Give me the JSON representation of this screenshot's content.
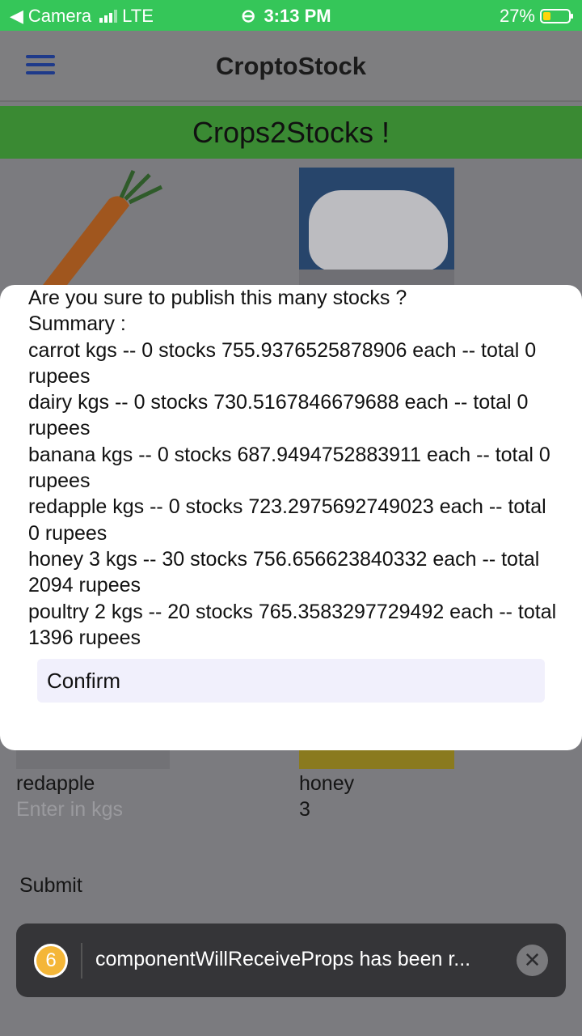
{
  "status_bar": {
    "back_app": "Camera",
    "network": "LTE",
    "time": "3:13 PM",
    "battery": "27%"
  },
  "header": {
    "title": "CroptoStock"
  },
  "banner": {
    "text": "Crops2Stocks !"
  },
  "grid": {
    "redapple_label": "redapple",
    "redapple_placeholder": "Enter in kgs",
    "honey_label": "honey",
    "honey_value": "3"
  },
  "submit_label": "Submit",
  "modal": {
    "lines": [
      "Are you sure to publish this many stocks ?",
      "Summary :",
      "carrot  kgs -- 0 stocks 755.9376525878906 each -- total 0 rupees",
      "dairy  kgs -- 0 stocks 730.5167846679688 each -- total 0 rupees",
      "banana  kgs -- 0 stocks 687.9494752883911 each -- total 0 rupees",
      "redapple  kgs -- 0 stocks 723.2975692749023 each -- total 0 rupees",
      "honey 3 kgs -- 30 stocks 756.656623840332 each -- total 2094 rupees",
      "poultry 2 kgs -- 20 stocks 765.3583297729492 each -- total 1396 rupees"
    ],
    "confirm_label": "Confirm"
  },
  "toast": {
    "count": "6",
    "message": "componentWillReceiveProps has been r..."
  },
  "colors": {
    "status_bar": "#35c659",
    "banner": "#3a8a33",
    "confirm_bg": "#f1f0fc",
    "toast_badge": "#f4b638"
  }
}
